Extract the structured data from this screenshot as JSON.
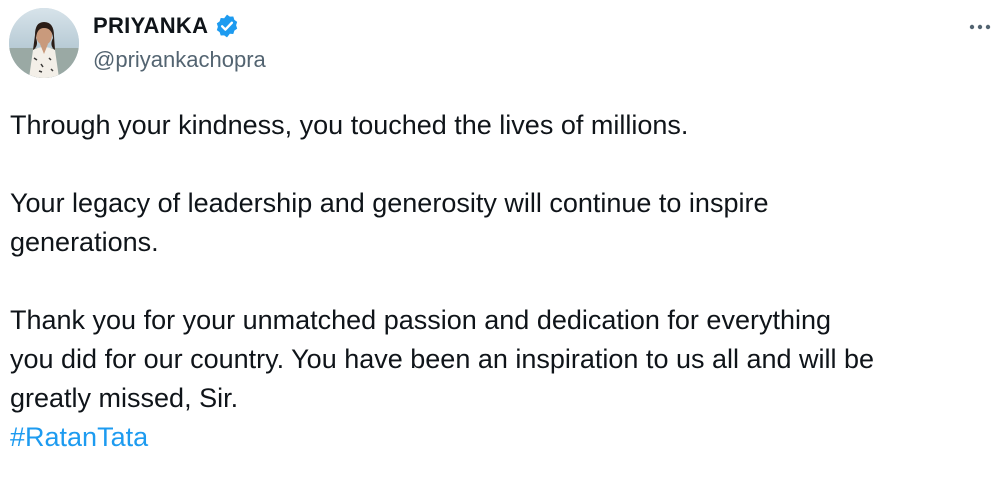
{
  "author": {
    "display_name": "PRIYANKA",
    "handle": "@priyankachopra",
    "verified_badge_icon": "verified-check-icon",
    "verified_color": "#1d9bf0"
  },
  "menu": {
    "more_icon": "more-horizontal-icon"
  },
  "tweet": {
    "paragraph_1": "Through your kindness, you touched the lives of millions.",
    "paragraph_2_line_1": "Your legacy of leadership and generosity will continue to inspire",
    "paragraph_2_line_2": "generations.",
    "paragraph_3_line_1": "Thank you for your unmatched passion and dedication for everything",
    "paragraph_3_line_2": "you did for our country. You have been an inspiration to us all and will be",
    "paragraph_3_line_3": "greatly missed, Sir.",
    "hashtag": "#RatanTata",
    "hashtag_color": "#1d9bf0"
  }
}
